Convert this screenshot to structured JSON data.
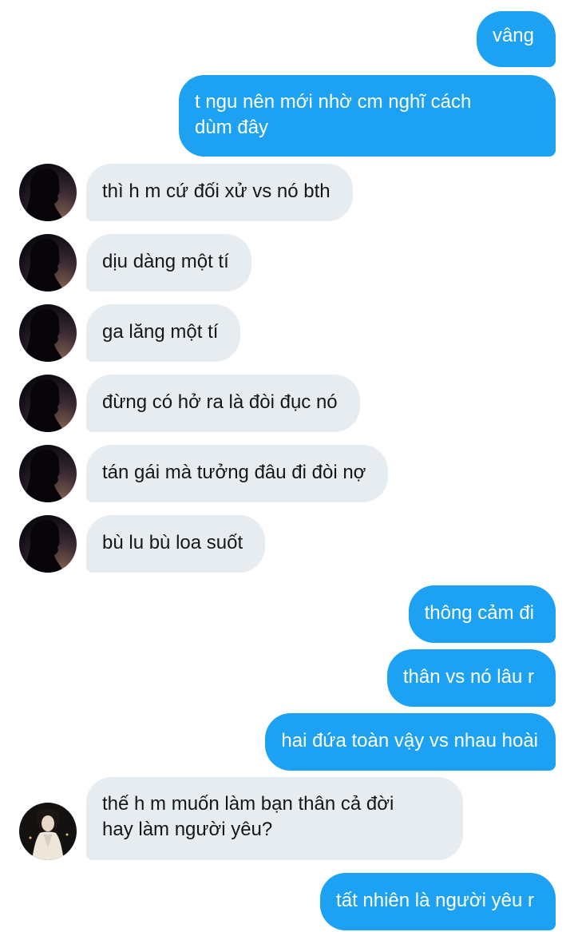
{
  "conversation": {
    "messages": [
      {
        "sender": "me",
        "text": "vâng"
      },
      {
        "sender": "me",
        "line1": "t ngu nên mới nhờ cm nghĩ cách",
        "line2": "dùm đây"
      },
      {
        "sender": "them",
        "avatar": "silhouette-avatar",
        "text": "thì h m cứ đối xử vs nó bth"
      },
      {
        "sender": "them",
        "avatar": "silhouette-avatar",
        "text": "dịu dàng một tí"
      },
      {
        "sender": "them",
        "avatar": "silhouette-avatar",
        "text": "ga lăng một tí"
      },
      {
        "sender": "them",
        "avatar": "silhouette-avatar",
        "text": "đừng có hở ra là đòi đục nó"
      },
      {
        "sender": "them",
        "avatar": "silhouette-avatar",
        "text": "tán gái mà tưởng đâu đi đòi nợ"
      },
      {
        "sender": "them",
        "avatar": "silhouette-avatar",
        "text": "bù lu bù loa suốt"
      },
      {
        "sender": "me",
        "text": "thông cảm đi"
      },
      {
        "sender": "me",
        "text": "thân vs nó lâu r"
      },
      {
        "sender": "me",
        "text": "hai đứa toàn vậy vs nhau hoài"
      },
      {
        "sender": "them",
        "avatar": "portrait-avatar",
        "line1": "thế h m muốn làm bạn thân cả đời",
        "line2": "hay làm người yêu?"
      },
      {
        "sender": "me",
        "text": "tất nhiên là người yêu r"
      }
    ]
  },
  "colors": {
    "outgoing_bubble": "#1da1f2",
    "incoming_bubble": "#e6ecf0",
    "outgoing_text": "#ffffff",
    "incoming_text": "#14171a"
  }
}
